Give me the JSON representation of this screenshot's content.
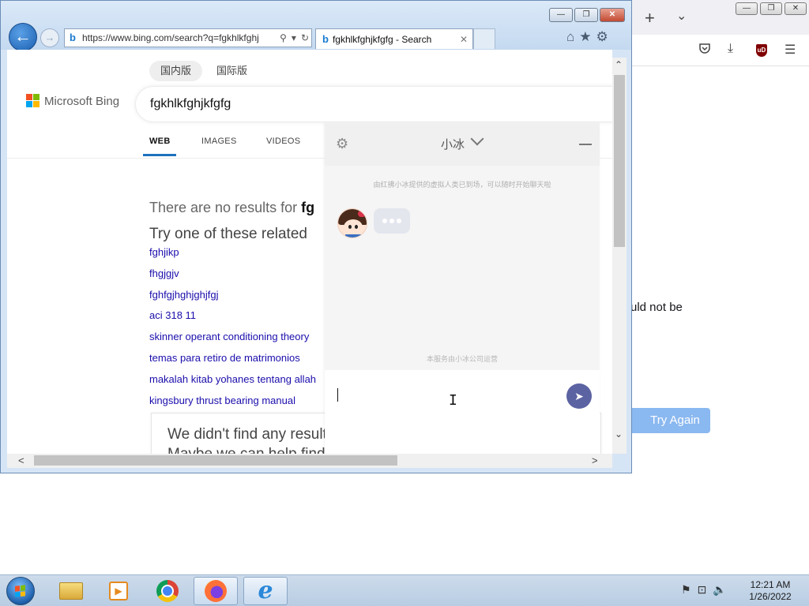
{
  "firefox": {
    "new_tab_symbol": "+",
    "tabs_menu_symbol": "⌄",
    "minimize_symbol": "—",
    "restore_symbol": "❐",
    "close_symbol": "✕",
    "pocket_icon": "pocket-icon",
    "download_symbol": "⤓",
    "ublock_label": "uD",
    "menu_symbol": "☰",
    "error_text_fragment": "uld not be",
    "try_again_label": "Try Again"
  },
  "ie": {
    "minimize_symbol": "—",
    "restore_symbol": "❐",
    "close_symbol": "✕",
    "back_symbol": "←",
    "forward_symbol": "→",
    "address_url": "https://www.bing.com/search?q=fgkhlkfghj",
    "search_symbol": "⚲",
    "refresh_symbol": "↻",
    "tab_title": "fgkhlkfghjkfgfg - Search",
    "tab_close_symbol": "✕",
    "home_symbol": "⌂",
    "favorites_symbol": "★",
    "tools_symbol": "⚙",
    "favicon_letter": "b"
  },
  "bing": {
    "market_tabs": [
      "国内版",
      "国际版"
    ],
    "logo_text": "Microsoft Bing",
    "search_query": "fgkhlkfghjkfgfg",
    "scope_tabs": [
      "WEB",
      "IMAGES",
      "VIDEOS"
    ],
    "no_results_prefix": "There are no results for ",
    "no_results_query": "fg",
    "related_heading": "Try one of these related",
    "related_searches": [
      "fghjikp",
      "fhgjgjv",
      "fghfgjhghjghjfgj",
      "aci 318 11",
      "skinner operant conditioning theory",
      "temas para retiro de matrimonios",
      "makalah kitab yohanes tentang allah",
      "kingsbury thrust bearing manual"
    ],
    "didnt_find_heading": "We didn't find any results",
    "didnt_find_sub": "Maybe we can help find his family"
  },
  "chat": {
    "title": "小冰",
    "notice": "由红拂小冰提供的虚拟人类已到场，可以随时开始聊天啦",
    "footer_note": "本服务由小冰公司运营",
    "send_symbol": "➤",
    "gear_symbol": "⚙"
  },
  "taskbar": {
    "clock_time": "12:21 AM",
    "clock_date": "1/26/2022",
    "tray_flag_symbol": "⚑",
    "tray_network_symbol": "⊡",
    "tray_volume_symbol": "🔈",
    "media_symbol": "▶",
    "ie_letter": "e"
  },
  "mouse": {
    "cursor_symbol": "I"
  }
}
